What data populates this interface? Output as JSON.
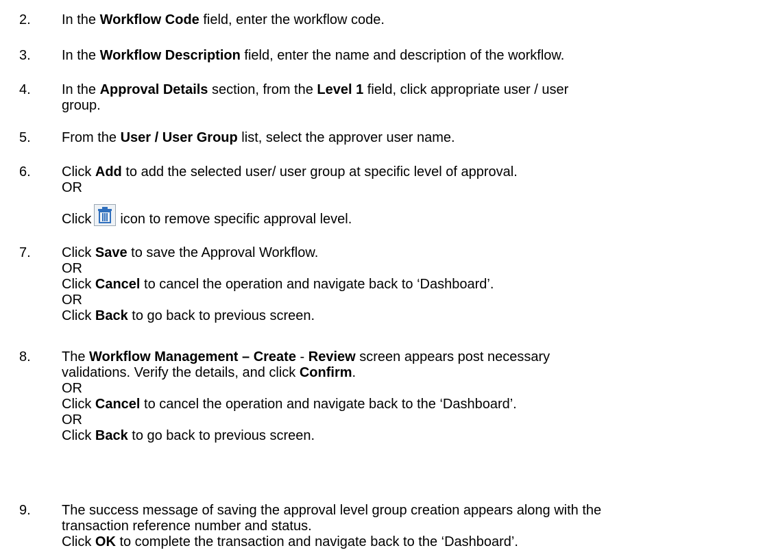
{
  "steps": [
    {
      "num": "2.",
      "parts": [
        "In the ",
        "Workflow Code",
        " field, enter the workflow code."
      ]
    },
    {
      "num": "3.",
      "parts": [
        "In the ",
        "Workflow Description",
        " field, enter the name and description of the workflow."
      ]
    },
    {
      "num": "4.",
      "line1": [
        "In the ",
        "Approval Details",
        " section, from the ",
        "Level 1",
        " field, click appropriate user / user"
      ],
      "line2": "group."
    },
    {
      "num": "5.",
      "parts": [
        "From the ",
        "User / User Group",
        " list, select the approver user name."
      ]
    },
    {
      "num": "6.",
      "line1": [
        "Click ",
        "Add",
        " to add the selected user/ user group at specific level of approval."
      ],
      "or": "OR",
      "line3a": "Click",
      "line3b": "icon to remove specific approval level.",
      "icon": "trash-icon"
    },
    {
      "num": "7.",
      "a": [
        "Click ",
        "Save",
        " to save the Approval Workflow."
      ],
      "or1": "OR",
      "b": [
        "Click ",
        "Cancel",
        " to cancel the operation and navigate back to ‘Dashboard’."
      ],
      "or2": "OR",
      "c": [
        "Click ",
        "Back",
        " to go back to previous screen."
      ]
    },
    {
      "num": "8.",
      "a": [
        "The ",
        "Workflow Management – Create",
        " - ",
        "Review",
        " screen appears post necessary"
      ],
      "a2": [
        "validations. Verify the details, and click ",
        "Confirm",
        "."
      ],
      "or1": "OR",
      "b": [
        "Click ",
        "Cancel",
        " to cancel the operation and navigate back to the ‘Dashboard’."
      ],
      "or2": "OR",
      "c": [
        "Click ",
        "Back",
        " to go back to previous screen."
      ]
    },
    {
      "num": "9.",
      "a": "The success message of saving the approval level group creation appears along with the",
      "a2": "transaction reference number and status.",
      "b": [
        "Click ",
        "OK",
        " to complete the transaction and navigate back to the ‘Dashboard’."
      ]
    }
  ],
  "colors": {
    "icon_border": "#9aa6b2",
    "icon_fill": "#2f6fbd"
  }
}
